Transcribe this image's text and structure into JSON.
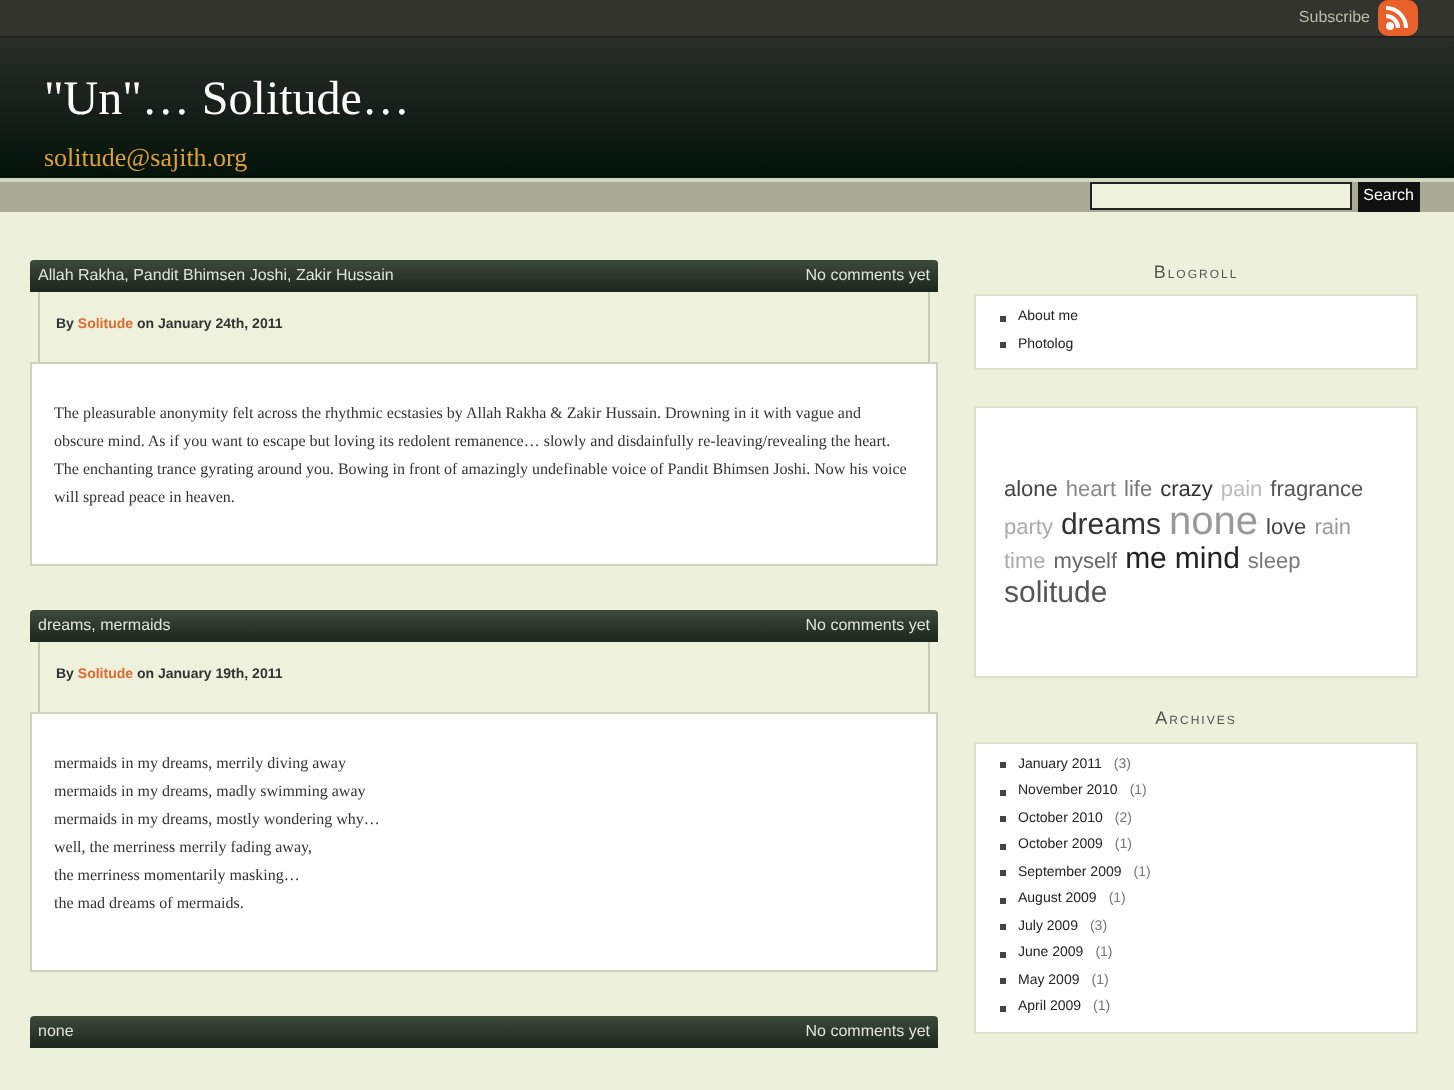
{
  "topbar": {
    "subscribe": "Subscribe"
  },
  "header": {
    "title": "\"Un\"… Solitude…",
    "subtitle": "solitude@sajith.org"
  },
  "search": {
    "button": "Search"
  },
  "posts": [
    {
      "tags": "Allah Rakha, Pandit Bhimsen Joshi, Zakir Hussain",
      "comments": "No comments yet",
      "by": "By",
      "author": "Solitude",
      "date": "on January 24th, 2011",
      "paragraphs": [
        "The pleasurable anonymity felt across the rhythmic ecstasies by Allah Rakha & Zakir Hussain. Drowning in it with vague and obscure mind. As if you want to escape but loving its redolent remanence… slowly and disdainfully re-leaving/revealing the heart. The enchanting trance gyrating around you. Bowing in front of amazingly undefinable voice of Pandit Bhimsen Joshi. Now his voice will spread peace in heaven."
      ]
    },
    {
      "tags": "dreams, mermaids",
      "comments": "No comments yet",
      "by": "By",
      "author": "Solitude",
      "date": "on January 19th, 2011",
      "lines": [
        "mermaids in my dreams, merrily diving away",
        "mermaids in my dreams, madly swimming away",
        "mermaids in my dreams, mostly wondering why…",
        "well, the merriness merrily fading away,",
        "the merriness momentarily masking…",
        "the mad dreams of mermaids."
      ]
    },
    {
      "tags": "none",
      "comments": "No comments yet"
    }
  ],
  "blogroll": {
    "title": "Blogroll",
    "items": [
      "About me",
      "Photolog"
    ]
  },
  "tag_cloud": [
    {
      "text": "alone",
      "kind": "small",
      "color": "#444444"
    },
    {
      "text": "heart",
      "kind": "small",
      "color": "#888888"
    },
    {
      "text": "life",
      "kind": "small",
      "color": "#777777"
    },
    {
      "text": "crazy",
      "kind": "small",
      "color": "#333333"
    },
    {
      "text": "pain",
      "kind": "small",
      "color": "#bbbbbb"
    },
    {
      "text": "fragrance",
      "kind": "small",
      "color": "#555555"
    },
    {
      "text": "party",
      "kind": "small",
      "color": "#aaaaaa"
    },
    {
      "text": "dreams",
      "kind": "medium",
      "color": "#333333"
    },
    {
      "text": "none",
      "kind": "large",
      "color": "#999999"
    },
    {
      "text": "love",
      "kind": "small",
      "color": "#444444"
    },
    {
      "text": "rain",
      "kind": "small",
      "color": "#999999"
    },
    {
      "text": "time",
      "kind": "small",
      "color": "#aaaaaa"
    },
    {
      "text": "myself",
      "kind": "small",
      "color": "#666666"
    },
    {
      "text": "me",
      "kind": "medium",
      "color": "#222222"
    },
    {
      "text": "mind",
      "kind": "medium",
      "color": "#222222"
    },
    {
      "text": "sleep",
      "kind": "small",
      "color": "#777777"
    },
    {
      "text": "solitude",
      "kind": "medium",
      "color": "#555555"
    }
  ],
  "archives": {
    "title": "Archives",
    "items": [
      {
        "label": "January 2011",
        "count": "(3)"
      },
      {
        "label": "November 2010",
        "count": "(1)"
      },
      {
        "label": "October 2010",
        "count": "(2)"
      },
      {
        "label": "October 2009",
        "count": "(1)"
      },
      {
        "label": "September 2009",
        "count": "(1)"
      },
      {
        "label": "August 2009",
        "count": "(1)"
      },
      {
        "label": "July 2009",
        "count": "(3)"
      },
      {
        "label": "June 2009",
        "count": "(1)"
      },
      {
        "label": "May 2009",
        "count": "(1)"
      },
      {
        "label": "April 2009",
        "count": "(1)"
      }
    ]
  }
}
